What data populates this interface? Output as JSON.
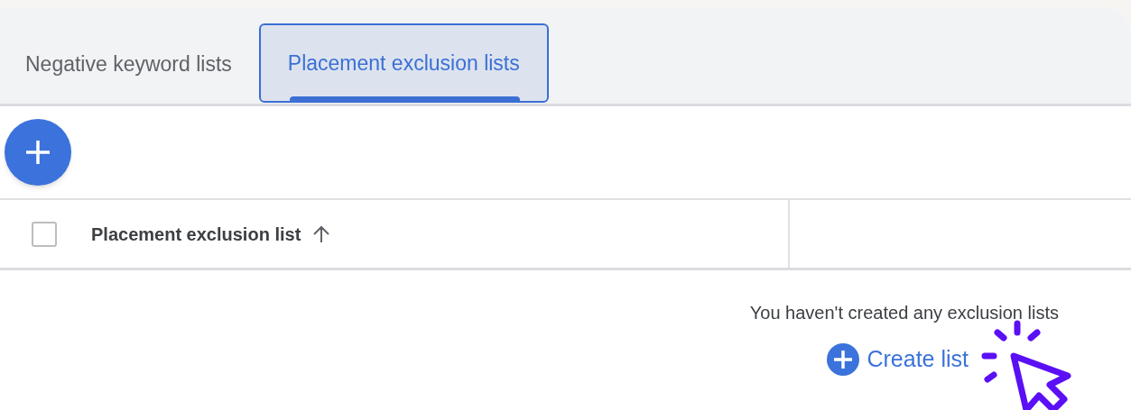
{
  "tabs": [
    {
      "label": "Negative keyword lists",
      "selected": false
    },
    {
      "label": "Placement exclusion lists",
      "selected": true
    }
  ],
  "table": {
    "select_all": {
      "checked": false
    },
    "columns": [
      {
        "label": "Placement exclusion list",
        "sort_ascending": true
      }
    ]
  },
  "empty_state": {
    "message": "You haven't created any exclusion lists",
    "action": "Create list"
  }
}
